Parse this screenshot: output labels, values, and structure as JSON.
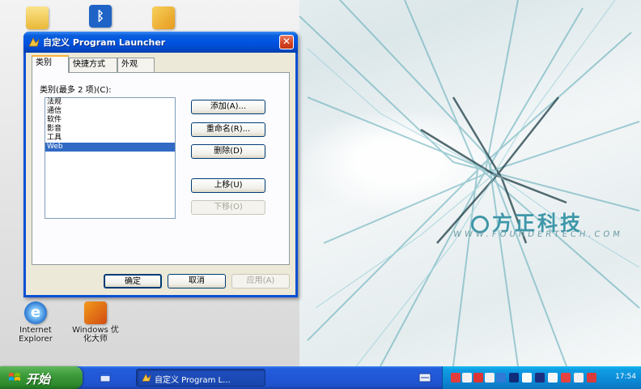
{
  "desktop": {
    "brand_text": "方正科技",
    "brand_url": "WWW.FOUNDERTECH.COM",
    "icons": [
      {
        "id": "ie",
        "label": "Internet Explorer"
      },
      {
        "id": "ws",
        "label": "Windows 优化大师"
      }
    ]
  },
  "dialog": {
    "title": "自定义 Program Launcher",
    "close_symbol": "✕",
    "tabs": [
      {
        "label": "类别",
        "active": true
      },
      {
        "label": "快捷方式",
        "active": false
      },
      {
        "label": "外观",
        "active": false
      }
    ],
    "list_label": "类别(最多 2 项)(C):",
    "categories": [
      {
        "label": "法规",
        "selected": false
      },
      {
        "label": "通信",
        "selected": false
      },
      {
        "label": "软件",
        "selected": false
      },
      {
        "label": "影音",
        "selected": false
      },
      {
        "label": "工具",
        "selected": false
      },
      {
        "label": "Web",
        "selected": true
      }
    ],
    "side_buttons": {
      "add": "添加(A)...",
      "rename": "重命名(R)...",
      "delete": "删除(D)",
      "move_up": "上移(U)",
      "move_down": "下移(O)"
    },
    "footer_buttons": {
      "ok": "确定",
      "cancel": "取消",
      "apply": "应用(A)"
    }
  },
  "taskbar": {
    "start_label": "开始",
    "task_item": "自定义 Program L...",
    "clock": "17:54"
  },
  "colors": {
    "titlebar": "#0054e3",
    "start_green": "#3c9a3a",
    "tray_blue": "#0c8ad6",
    "brand_teal": "#3f97a8",
    "selection": "#316ac5"
  }
}
